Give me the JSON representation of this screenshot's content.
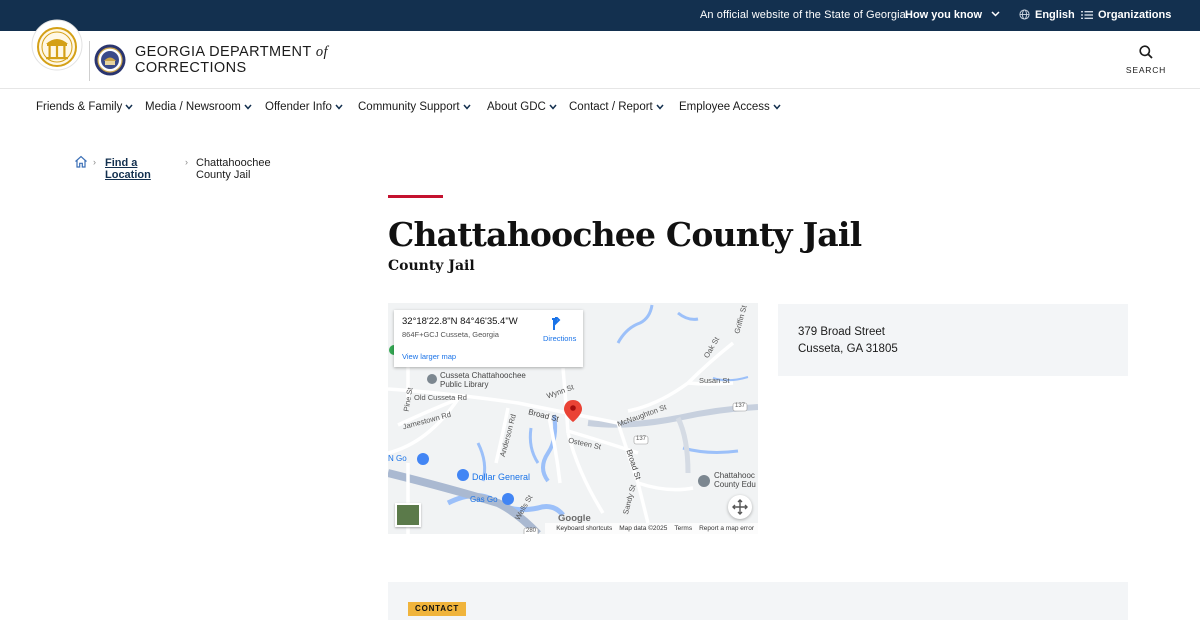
{
  "gov_bar": {
    "official_text": "An official website of the State of Georgia.",
    "how_you_know": "How you know",
    "language": "English",
    "organizations": "Organizations"
  },
  "header": {
    "dept_line1": "GEORGIA DEPARTMENT",
    "dept_of": "of",
    "dept_line2": "CORRECTIONS",
    "search_label": "SEARCH"
  },
  "nav": {
    "items": [
      {
        "label": "Friends & Family"
      },
      {
        "label": "Media / Newsroom"
      },
      {
        "label": "Offender Info"
      },
      {
        "label": "Community Support"
      },
      {
        "label": "About GDC"
      },
      {
        "label": "Contact / Report"
      },
      {
        "label": "Employee Access"
      }
    ]
  },
  "breadcrumb": {
    "link": "Find a Location",
    "current": "Chattahoochee County Jail"
  },
  "page": {
    "title": "Chattahoochee County Jail",
    "subtitle": "County Jail"
  },
  "map": {
    "coords": "32°18'22.8\"N 84°46'35.4\"W",
    "plus_code": "864F+GCJ Cusseta, Georgia",
    "view_larger": "View larger map",
    "directions": "Directions",
    "labels": {
      "library": "Cusseta Chattahoochee",
      "library2": "Public Library",
      "old_cusseta": "Old Cusseta Rd",
      "wynn": "Wynn St",
      "broad": "Broad St",
      "mcnaughton": "McNaughton St",
      "jamestown": "Jamestown Rd",
      "pine": "Pine St",
      "anderson": "Anderson Rd",
      "osteen": "Osteen St",
      "broad2": "Broad St",
      "susan": "Susan St",
      "dollar": "Dollar General",
      "gas": "Gas Go",
      "go": "N Go",
      "wells": "Wells St",
      "sandy": "Sandy St",
      "chatt1": "Chattahooc",
      "chatt2": "County Edu",
      "route": "137",
      "route2": "137",
      "route3": "280",
      "griffin": "Griffin St",
      "oak": "Oak St"
    },
    "google": "Google",
    "footer": {
      "shortcuts": "Keyboard shortcuts",
      "data": "Map data ©2025",
      "terms": "Terms",
      "report": "Report a map error"
    },
    "colors": {
      "land": "#f1f3f4",
      "water": "#9cc0f9",
      "road": "#ffffff",
      "highway": "#aab9d1",
      "pin": "#ea4335"
    }
  },
  "address": {
    "line1": "379 Broad Street",
    "line2": "Cusseta, GA 31805"
  },
  "contact": {
    "badge": "CONTACT"
  },
  "colors": {
    "gov_bar": "#13304f",
    "accent_red": "#c4122f",
    "badge": "#f0b43c",
    "panel": "#f3f5f7"
  }
}
